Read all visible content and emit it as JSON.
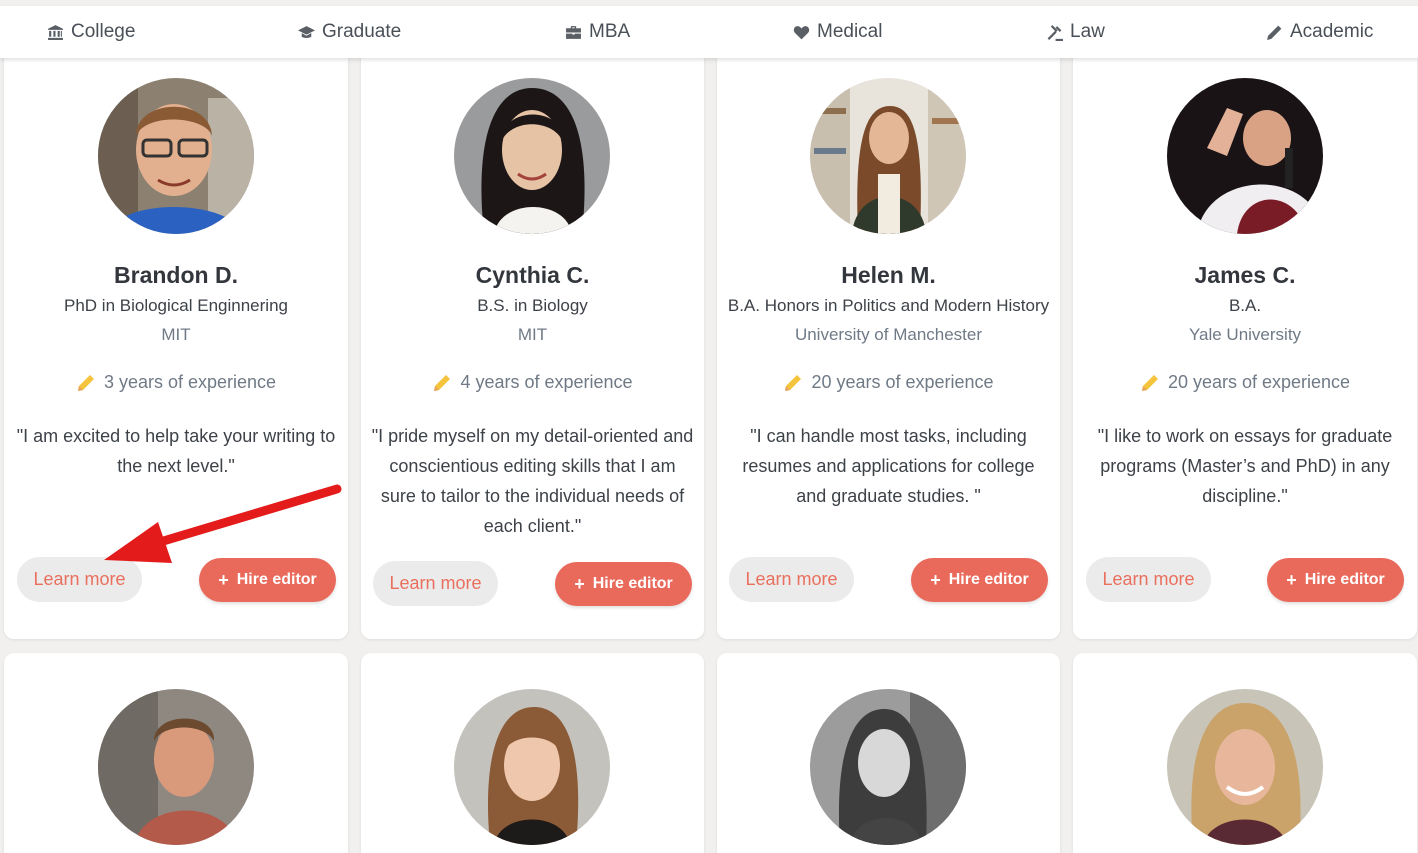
{
  "nav": {
    "items": [
      {
        "label": "College",
        "icon": "institution-icon"
      },
      {
        "label": "Graduate",
        "icon": "graduation-cap-icon"
      },
      {
        "label": "MBA",
        "icon": "briefcase-icon"
      },
      {
        "label": "Medical",
        "icon": "heart-icon"
      },
      {
        "label": "Law",
        "icon": "gavel-icon"
      },
      {
        "label": "Academic",
        "icon": "pencil-icon"
      }
    ]
  },
  "cards": [
    {
      "name": "Brandon D.",
      "degree": "PhD in Biological Enginnering",
      "school": "MIT",
      "experience": "3 years of experience",
      "quote": "\"I am excited to help take your writing to the next level.\"",
      "learn_label": "Learn more",
      "hire_label": "Hire editor"
    },
    {
      "name": "Cynthia C.",
      "degree": "B.S. in Biology",
      "school": "MIT",
      "experience": "4 years of experience",
      "quote": "\"I pride myself on my detail-oriented and conscientious editing skills that I am sure to tailor to the individual needs of each client.\"",
      "learn_label": "Learn more",
      "hire_label": "Hire editor"
    },
    {
      "name": "Helen M.",
      "degree": "B.A. Honors in Politics and Modern History",
      "school": "University of Manchester",
      "experience": "20 years of experience",
      "quote": "\"I can handle most tasks, including resumes and applications for college and graduate studies. \"",
      "learn_label": "Learn more",
      "hire_label": "Hire editor"
    },
    {
      "name": "James C.",
      "degree": "B.A.",
      "school": "Yale University",
      "experience": "20 years of experience",
      "quote": "\"I like to work on essays for graduate programs (Master’s and PhD) in any discipline.\"",
      "learn_label": "Learn more",
      "hire_label": "Hire editor"
    }
  ],
  "colors": {
    "accent": "#e9695a",
    "learn_text": "#ea6f5d",
    "annotation_arrow": "#e31b1b"
  }
}
